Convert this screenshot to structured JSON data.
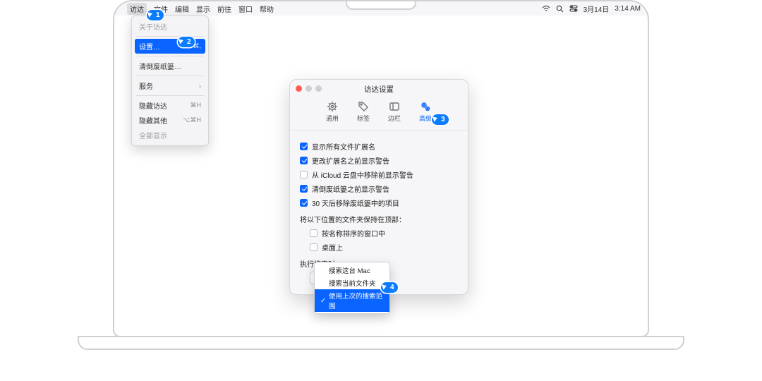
{
  "menubar": {
    "items": [
      "访达",
      "文件",
      "编辑",
      "显示",
      "前往",
      "窗口",
      "帮助"
    ],
    "date": "3月14日",
    "time": "3:14 AM"
  },
  "dropdown": {
    "items": [
      {
        "label": "关于访达",
        "disabled": true
      },
      {
        "sep": true
      },
      {
        "label": "设置…",
        "shortcut": "⌘,",
        "highlight": true
      },
      {
        "sep": true
      },
      {
        "label": "清倒废纸篓…",
        "shortcut": ""
      },
      {
        "sep": true
      },
      {
        "label": "服务",
        "shortcut": "›"
      },
      {
        "sep": true
      },
      {
        "label": "隐藏访达",
        "shortcut": "⌘H"
      },
      {
        "label": "隐藏其他",
        "shortcut": "⌥⌘H"
      },
      {
        "label": "全部显示",
        "disabled": true
      }
    ]
  },
  "window": {
    "title": "访达设置",
    "tabs": [
      "通用",
      "标签",
      "边栏",
      "高级"
    ],
    "active_tab": 3,
    "checks": [
      {
        "label": "显示所有文件扩展名",
        "on": true
      },
      {
        "label": "更改扩展名之前显示警告",
        "on": true
      },
      {
        "label": "从 iCloud 云盘中移除前显示警告",
        "on": false
      },
      {
        "label": "清倒废纸篓之前显示警告",
        "on": true
      },
      {
        "label": "30 天后移除废纸篓中的项目",
        "on": true
      }
    ],
    "keep_on_top_label": "将以下位置的文件夹保持在顶部：",
    "keep_on_top": [
      {
        "label": "按名称排序的窗口中",
        "on": false
      },
      {
        "label": "桌面上",
        "on": false
      }
    ],
    "search_label": "执行搜索时：",
    "select_value": "搜索这台 Mac",
    "popup": [
      {
        "label": "搜索这台 Mac"
      },
      {
        "label": "搜索当前文件夹"
      },
      {
        "label": "使用上次的搜索范围",
        "highlight": true,
        "checked": true
      }
    ]
  },
  "steps": {
    "1": "1",
    "2": "2",
    "3": "3",
    "4": "4"
  }
}
